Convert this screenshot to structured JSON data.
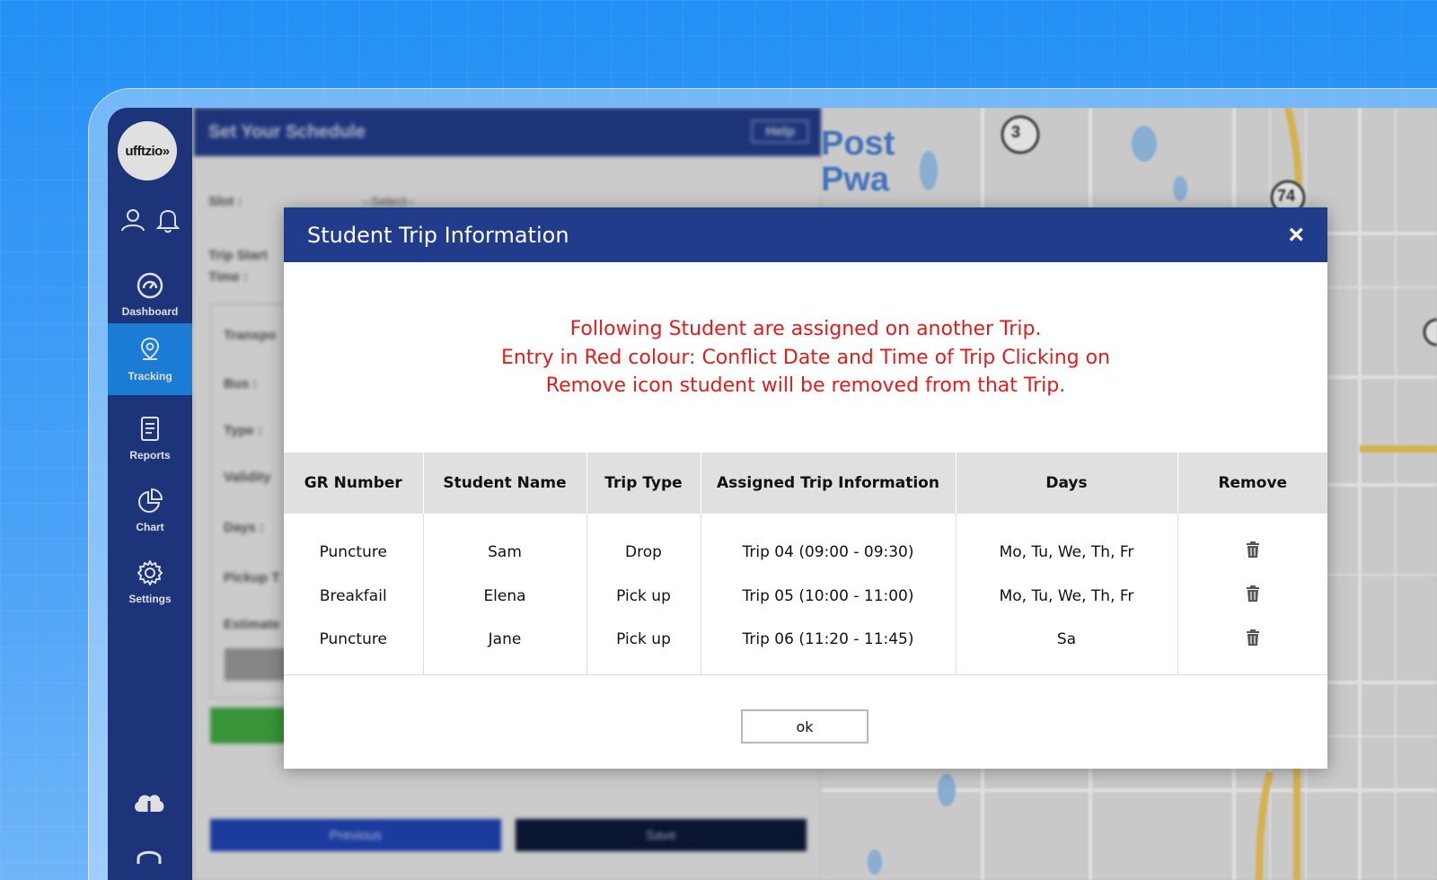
{
  "app": {
    "logo_text": "ufftzio»"
  },
  "sidebar": {
    "items": [
      {
        "label": "Dashboard",
        "icon": "speedometer-icon"
      },
      {
        "label": "Tracking",
        "icon": "location-pin-icon",
        "active": true
      },
      {
        "label": "Reports",
        "icon": "document-icon"
      },
      {
        "label": "Chart",
        "icon": "pie-chart-icon"
      },
      {
        "label": "Settings",
        "icon": "gear-icon"
      }
    ]
  },
  "form": {
    "title": "Set Your Schedule",
    "help_label": "Help",
    "slot_label": "Slot :",
    "slot_value": "--Select--",
    "trip_start_label": "Trip Start",
    "time_label": "Time :",
    "fields": [
      "Transpo",
      "Bus :",
      "Type :",
      "Validity",
      "Days :",
      "Pickup T",
      "Estimate"
    ],
    "previous_label": "Previous",
    "save_label": "Save"
  },
  "map": {
    "line1": "Post",
    "line2": "Pwa",
    "marker_3": "3",
    "marker_74": "74"
  },
  "modal": {
    "title": "Student Trip Information",
    "close": "×",
    "message_lines": [
      "Following Student are assigned on another Trip.",
      "Entry in Red colour: Conflict Date and Time of Trip Clicking on",
      "Remove icon student will be removed from that Trip."
    ],
    "columns": [
      "GR Number",
      "Student Name",
      "Trip Type",
      "Assigned Trip Information",
      "Days",
      "Remove"
    ],
    "rows": [
      {
        "gr": "Puncture",
        "name": "Sam",
        "type": "Drop",
        "trip": "Trip 04  (09:00 - 09:30)",
        "days": "Mo, Tu, We, Th, Fr"
      },
      {
        "gr": "Breakfail",
        "name": "Elena",
        "type": "Pick up",
        "trip": "Trip 05  (10:00 - 11:00)",
        "days": "Mo, Tu, We, Th, Fr"
      },
      {
        "gr": "Puncture",
        "name": "Jane",
        "type": "Pick up",
        "trip": "Trip 06 (11:20 - 11:45)",
        "days": "Sa"
      }
    ],
    "ok_label": "ok"
  },
  "colors": {
    "primary": "#223c8c",
    "accent": "#1e8ef2",
    "warning_text": "#e21c1c"
  }
}
